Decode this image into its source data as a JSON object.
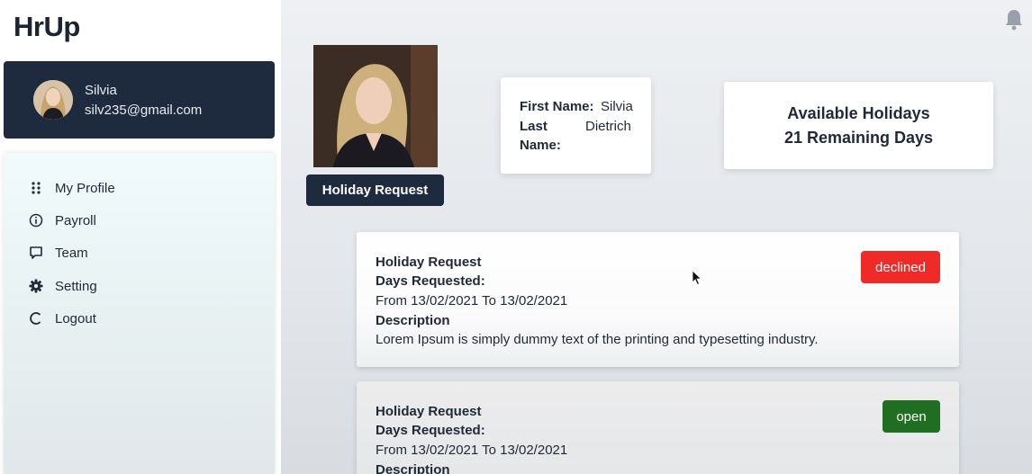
{
  "app": {
    "logo": "HrUp"
  },
  "user": {
    "name": "Silvia",
    "email": "silv235@gmail.com"
  },
  "nav": {
    "items": [
      {
        "label": "My Profile",
        "icon": "grid-dots-icon"
      },
      {
        "label": "Payroll",
        "icon": "info-icon"
      },
      {
        "label": "Team",
        "icon": "chat-icon"
      },
      {
        "label": "Setting",
        "icon": "gear-icon"
      },
      {
        "label": "Logout",
        "icon": "logout-icon"
      }
    ]
  },
  "profile": {
    "holiday_request_button": "Holiday Request",
    "first_name_label": "First Name:",
    "first_name": "Silvia",
    "last_name_label_1": "Last",
    "last_name_label_2": "Name:",
    "last_name": "Dietrich"
  },
  "holidays": {
    "title": "Available Holidays",
    "remaining": "21 Remaining Days"
  },
  "requests": [
    {
      "title": "Holiday Request",
      "days_label": "Days Requested:",
      "range": "From 13/02/2021 To 13/02/2021",
      "description_label": "Description",
      "description": "Lorem Ipsum is simply dummy text of the printing and typesetting industry.",
      "status": "declined",
      "status_color": "#f02a26"
    },
    {
      "title": "Holiday Request",
      "days_label": "Days Requested:",
      "range": "From 13/02/2021 To 13/02/2021",
      "description_label": "Description",
      "status": "open",
      "status_color": "#1f6e21"
    }
  ],
  "colors": {
    "navy": "#1e2a3d",
    "declined": "#f02a26",
    "open": "#1f6e21"
  }
}
